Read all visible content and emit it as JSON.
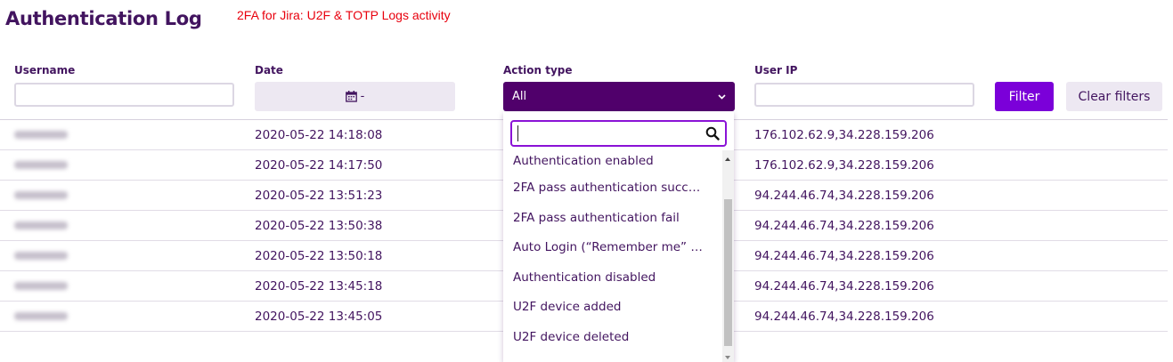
{
  "header": {
    "title": "Authentication Log",
    "caption": "2FA for Jira: U2F & TOTP Logs activity"
  },
  "filters": {
    "username_label": "Username",
    "username_value": "",
    "date_label": "Date",
    "date_value": "-",
    "action_label": "Action type",
    "action_value": "All",
    "ip_label": "User IP",
    "ip_value": "",
    "filter_button": "Filter",
    "clear_button": "Clear filters"
  },
  "dropdown": {
    "search_value": "",
    "options": [
      "Authentication enabled",
      "2FA pass authentication succ…",
      "2FA pass authentication fail",
      "Auto Login (“Remember me” …",
      "Authentication disabled",
      "U2F device added",
      "U2F device deleted"
    ]
  },
  "rows": [
    {
      "date": "2020-05-22 14:18:08",
      "ip": "176.102.62.9,34.228.159.206"
    },
    {
      "date": "2020-05-22 14:17:50",
      "ip": "176.102.62.9,34.228.159.206"
    },
    {
      "date": "2020-05-22 13:51:23",
      "ip": "94.244.46.74,34.228.159.206"
    },
    {
      "date": "2020-05-22 13:50:38",
      "ip": "94.244.46.74,34.228.159.206"
    },
    {
      "date": "2020-05-22 13:50:18",
      "ip": "94.244.46.74,34.228.159.206"
    },
    {
      "date": "2020-05-22 13:45:18",
      "ip": "94.244.46.74,34.228.159.206"
    },
    {
      "date": "2020-05-22 13:45:05",
      "ip": "94.244.46.74,34.228.159.206"
    }
  ],
  "icons": {
    "calendar": "calendar-icon",
    "chevron": "chevron-down-icon",
    "search": "search-icon"
  },
  "colors": {
    "primary": "#50006b",
    "accent": "#7b00d9",
    "text": "#42145f",
    "caption": "#e8000d"
  }
}
